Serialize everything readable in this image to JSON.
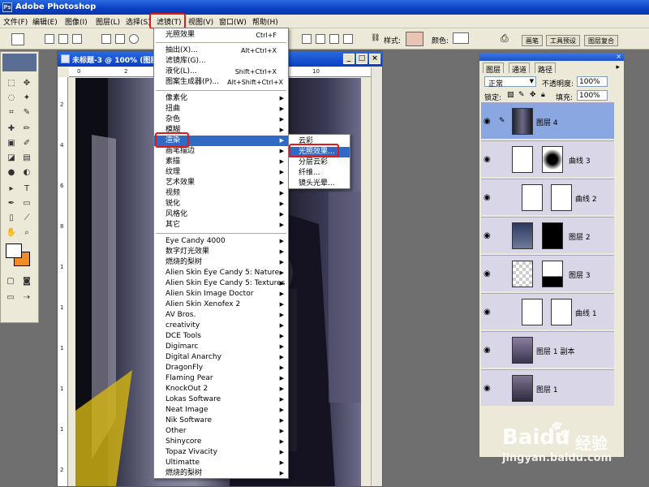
{
  "app": {
    "title": "Adobe Photoshop"
  },
  "menubar": [
    "文件(F)",
    "编辑(E)",
    "图像(I)",
    "图层(L)",
    "选择(S)",
    "滤镜(T)",
    "视图(V)",
    "窗口(W)",
    "帮助(H)"
  ],
  "options": {
    "style_label": "样式:",
    "color_label": "颜色:",
    "tabs": [
      "画笔",
      "工具预设",
      "图层复合"
    ]
  },
  "document": {
    "title": "未标题-3 @ 100% (图层 4, RGB/8)",
    "ruler_top": [
      "0",
      "2",
      "4",
      "6",
      "8",
      "10"
    ],
    "ruler_left": [
      "2",
      "4",
      "6",
      "8",
      "1",
      "1",
      "1",
      "1",
      "1",
      "2"
    ]
  },
  "filter_menu": [
    {
      "label": "光照效果",
      "shortcut": "Ctrl+F"
    },
    {
      "label": "抽出(X)...",
      "shortcut": "Alt+Ctrl+X"
    },
    {
      "label": "滤镜库(G)..."
    },
    {
      "label": "液化(L)...",
      "shortcut": "Shift+Ctrl+X"
    },
    {
      "label": "图案生成器(P)...",
      "shortcut": "Alt+Shift+Ctrl+X"
    },
    {
      "label": "像素化"
    },
    {
      "label": "扭曲"
    },
    {
      "label": "杂色"
    },
    {
      "label": "模糊"
    },
    {
      "label": "渲染"
    },
    {
      "label": "画笔描边"
    },
    {
      "label": "素描"
    },
    {
      "label": "纹理"
    },
    {
      "label": "艺术效果"
    },
    {
      "label": "视频"
    },
    {
      "label": "锐化"
    },
    {
      "label": "风格化"
    },
    {
      "label": "其它"
    },
    {
      "label": "Eye Candy 4000"
    },
    {
      "label": "数字灯光效果"
    },
    {
      "label": "燃烧的梨树"
    },
    {
      "label": "Alien Skin Eye Candy 5: Nature"
    },
    {
      "label": "Alien Skin Eye Candy 5: Textures"
    },
    {
      "label": "Alien Skin Image Doctor"
    },
    {
      "label": "Alien Skin Xenofex 2"
    },
    {
      "label": "AV Bros."
    },
    {
      "label": "creativity"
    },
    {
      "label": "DCE Tools"
    },
    {
      "label": "Digimarc"
    },
    {
      "label": "Digital Anarchy"
    },
    {
      "label": "DragonFly"
    },
    {
      "label": "Flaming Pear"
    },
    {
      "label": "KnockOut 2"
    },
    {
      "label": "Lokas Software"
    },
    {
      "label": "Neat Image"
    },
    {
      "label": "Nik Software"
    },
    {
      "label": "Other"
    },
    {
      "label": "Shinycore"
    },
    {
      "label": "Topaz Vivacity"
    },
    {
      "label": "Ultimatte"
    },
    {
      "label": "燃烧的梨树"
    }
  ],
  "render_submenu": [
    "云彩",
    "光照效果...",
    "分层云彩",
    "纤维...",
    "镜头光晕..."
  ],
  "layers": {
    "tabs": [
      "图层",
      "通道",
      "路径"
    ],
    "blend_mode": "正常",
    "opacity_label": "不透明度:",
    "opacity": "100%",
    "lock_label": "锁定:",
    "fill_label": "填充:",
    "fill": "100%",
    "rows": [
      {
        "name": "图层 4",
        "selected": true
      },
      {
        "name": "曲线 3"
      },
      {
        "name": "曲线 2"
      },
      {
        "name": "图层 2"
      },
      {
        "name": "图层 3"
      },
      {
        "name": "曲线 1"
      },
      {
        "name": "图层 1 副本"
      },
      {
        "name": "图层 1"
      }
    ]
  },
  "watermark": {
    "brand": "Baidu",
    "sub": "经验",
    "url": "jingyan.baidu.com"
  },
  "colors": {
    "highlight": "#316ac5",
    "annotation": "#e0191c",
    "foreground": "#ffffff",
    "background": "#f08c28"
  }
}
